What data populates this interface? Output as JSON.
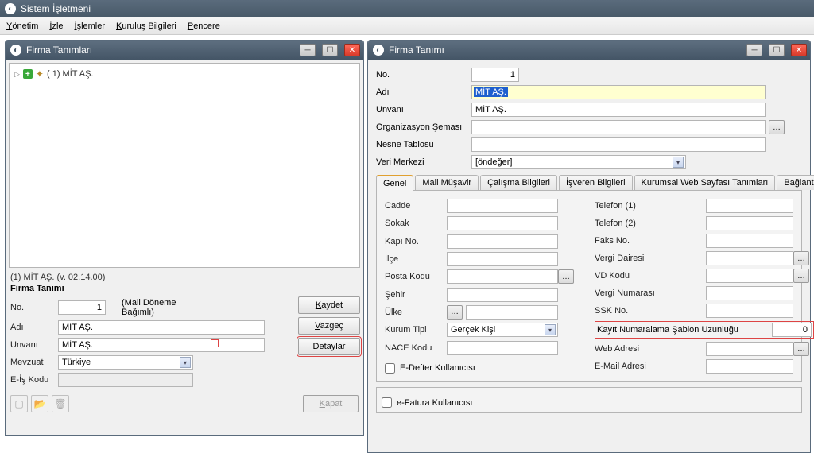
{
  "app": {
    "title": "Sistem İşletmeni"
  },
  "menu": {
    "yonetim": "Yönetim",
    "izle": "İzle",
    "islemler": "İşlemler",
    "kurulus": "Kuruluş Bilgileri",
    "pencere": "Pencere"
  },
  "win1": {
    "title": "Firma Tanımları",
    "tree_item": "(   1) MİT AŞ.",
    "path": "(1) MİT AŞ.  (v. 02.14.00)",
    "section": "Firma Tanımı",
    "labels": {
      "no": "No.",
      "bagimli": "(Mali Döneme Bağımlı)",
      "adi": "Adı",
      "unvani": "Unvanı",
      "mevzuat": "Mevzuat",
      "eis": "E-İş Kodu"
    },
    "values": {
      "no": "1",
      "adi": "MİT AŞ.",
      "unvani": "MİT AŞ.",
      "mevzuat": "Türkiye",
      "eis": ""
    },
    "buttons": {
      "kaydet": "Kaydet",
      "vazgec": "Vazgeç",
      "detaylar": "Detaylar",
      "kapat": "Kapat"
    }
  },
  "win2": {
    "title": "Firma Tanımı",
    "labels": {
      "no": "No.",
      "adi": "Adı",
      "unvani": "Unvanı",
      "org": "Organizasyon Şeması",
      "nesne": "Nesne Tablosu",
      "veri": "Veri Merkezi"
    },
    "values": {
      "no": "1",
      "adi": "MİT AŞ.",
      "unvani": "MİT AŞ.",
      "org": "",
      "nesne": "",
      "veri": "[öndeğer]"
    },
    "tabs": {
      "genel": "Genel",
      "mali": "Mali Müşavir",
      "calisma": "Çalışma Bilgileri",
      "isveren": "İşveren Bilgileri",
      "kurumsal": "Kurumsal Web Sayfası Tanımları",
      "baglanti": "Bağlantı Ayarları"
    },
    "addr": {
      "cadde": "Cadde",
      "sokak": "Sokak",
      "kapi": "Kapı No.",
      "ilce": "İlçe",
      "posta": "Posta Kodu",
      "sehir": "Şehir",
      "ulke": "Ülke",
      "kurum": "Kurum Tipi",
      "nace": "NACE Kodu",
      "kurum_val": "Gerçek Kişi",
      "edefter": "E-Defter Kullanıcısı",
      "efatura": "e-Fatura Kullanıcısı"
    },
    "contact": {
      "tel1": "Telefon (1)",
      "tel2": "Telefon (2)",
      "faks": "Faks No.",
      "vergid": "Vergi Dairesi",
      "vdkod": "VD Kodu",
      "vergin": "Vergi Numarası",
      "ssk": "SSK No.",
      "kayit": "Kayıt Numaralama Şablon Uzunluğu",
      "kayit_val": "0",
      "web": "Web Adresi",
      "email": "E-Mail Adresi"
    }
  }
}
